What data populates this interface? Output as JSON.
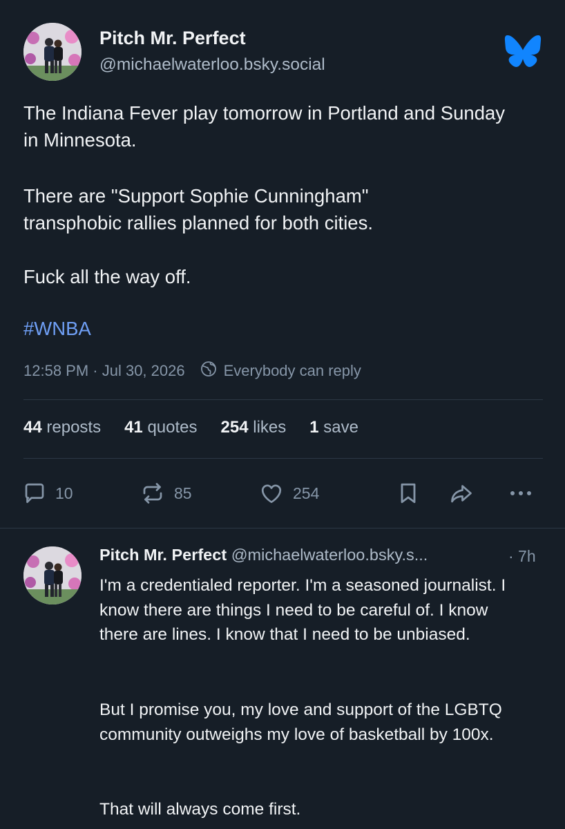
{
  "post": {
    "author_name": "Pitch Mr. Perfect",
    "author_handle": "@michaelwaterloo.bsky.social",
    "paragraphs": [
      "The Indiana Fever play tomorrow in Portland and Sunday in Minnesota.",
      "There are \"Support Sophie Cunningham\" transphobic rallies planned for both cities.",
      "Fuck all the way off."
    ],
    "hashtag": "#WNBA",
    "timestamp": "12:58 PM · Jul 30, 2026",
    "reply_setting": "Everybody can reply",
    "stats": {
      "reposts_count": "44",
      "reposts_label": "reposts",
      "quotes_count": "41",
      "quotes_label": "quotes",
      "likes_count": "254",
      "likes_label": "likes",
      "saves_count": "1",
      "saves_label": "save"
    },
    "actions": {
      "reply_count": "10",
      "repost_count": "85",
      "like_count": "254"
    }
  },
  "reply": {
    "author_name": "Pitch Mr. Perfect",
    "author_handle": "@michaelwaterloo.bsky.s...",
    "time": "· 7h",
    "paragraphs": [
      "I'm a credentialed reporter. I'm a seasoned journalist. I know there are things I need to be careful of. I know there are lines. I know that I need to be unbiased.",
      "But I promise you, my love and support of the LGBTQ community outweighs my love of basketball by 100x.",
      "That will always come first."
    ]
  },
  "icons": [
    "bluesky-butterfly-icon",
    "globe-icon",
    "reply-icon",
    "repost-icon",
    "like-icon",
    "bookmark-icon",
    "share-icon",
    "more-icon"
  ],
  "colors": {
    "background": "#161e27",
    "accent": "#6f9ff5",
    "brand": "#1185fe",
    "muted": "#8696a8"
  }
}
